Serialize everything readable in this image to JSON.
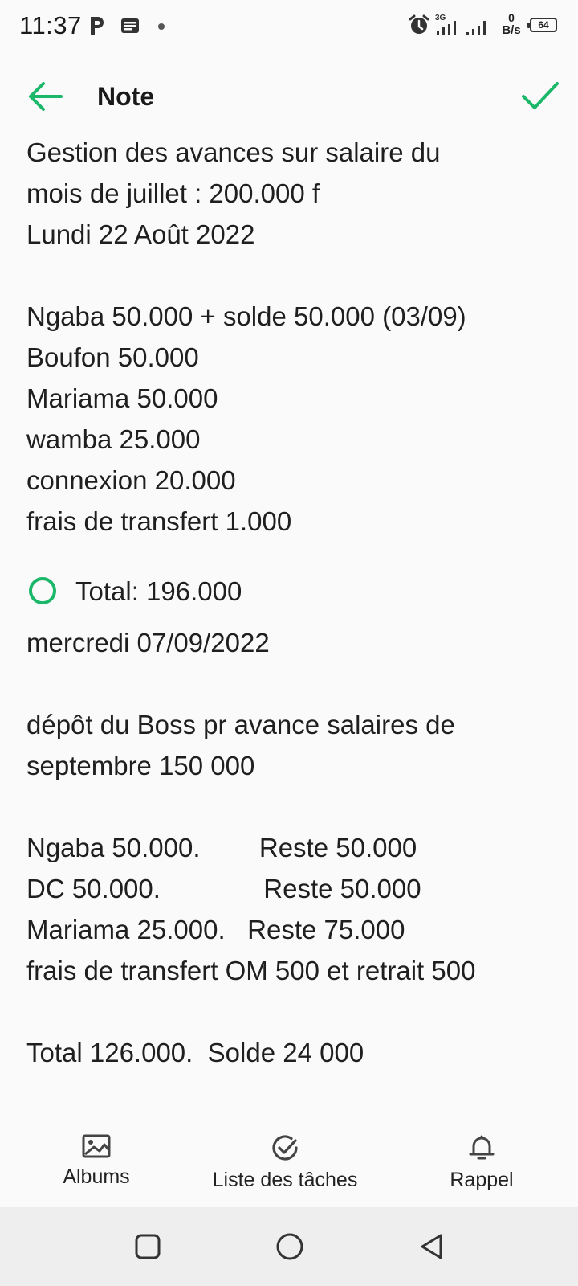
{
  "status_bar": {
    "time": "11:37",
    "speed_value": "0",
    "speed_unit": "B/s",
    "battery": "64",
    "network": "3G"
  },
  "app_bar": {
    "title": "Note",
    "back_icon": "arrow-left-icon",
    "confirm_icon": "checkmark-icon",
    "accent_color": "#1cb86a"
  },
  "note": {
    "lines_part1": [
      "Gestion des avances sur salaire du",
      "mois de juillet : 200.000 f",
      "Lundi 22 Août 2022",
      "",
      "Ngaba 50.000 + solde 50.000 (03/09)",
      "Boufon 50.000",
      "Mariama 50.000",
      "wamba 25.000",
      "connexion 20.000",
      "frais de transfert 1.000"
    ],
    "todo_item": "Total: 196.000",
    "lines_part2": [
      "mercredi 07/09/2022",
      "",
      "dépôt du Boss pr avance salaires de",
      "septembre 150 000",
      "",
      "Ngaba 50.000.        Reste 50.000",
      "DC 50.000.              Reste 50.000",
      "Mariama 25.000.   Reste 75.000",
      "frais de transfert OM 500 et retrait 500",
      "",
      "Total 126.000.  Solde 24 000"
    ]
  },
  "toolbar": {
    "albums_label": "Albums",
    "albums_icon": "image-icon",
    "tasks_label": "Liste des tâches",
    "tasks_icon": "check-circle-icon",
    "reminder_label": "Rappel",
    "reminder_icon": "bell-icon"
  },
  "nav_bar": {
    "recents_icon": "square-icon",
    "home_icon": "circle-icon",
    "back_icon": "triangle-back-icon"
  }
}
